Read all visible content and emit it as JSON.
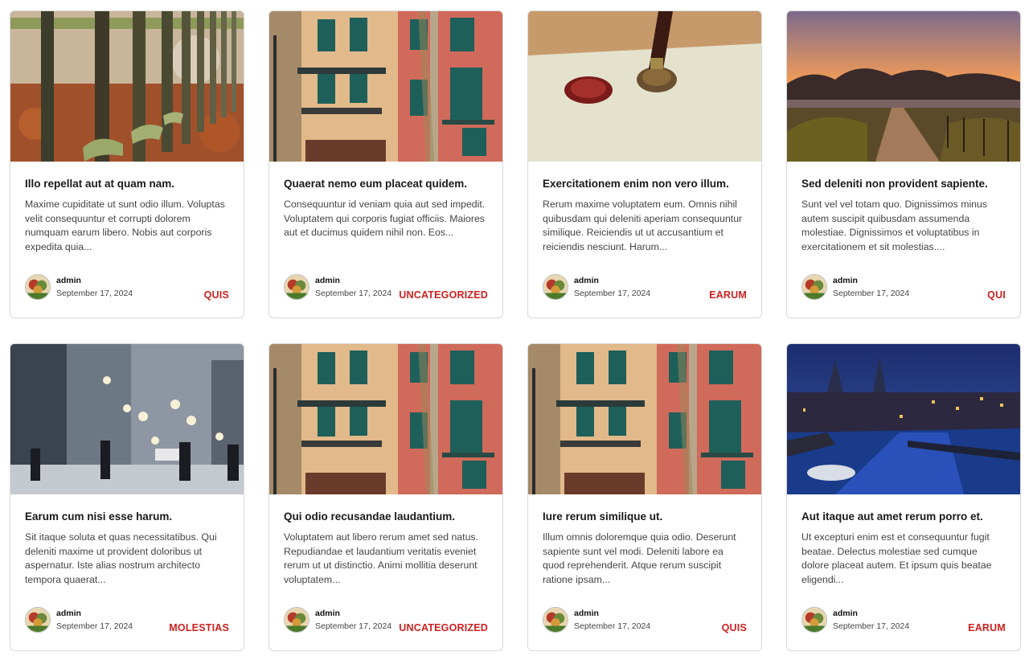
{
  "colors": {
    "accent": "#d0201f",
    "card_border": "#d9d9d9"
  },
  "posts": [
    {
      "image": "wooden-fence-photo",
      "title": "Illo repellat aut at quam nam.",
      "excerpt": "Maxime cupiditate ut sunt odio illum. Voluptas velit consequuntur et corrupti dolorem numquam earum libero. Nobis aut corporis expedita quia...",
      "author": "admin",
      "date": "September 17, 2024",
      "category": "QUIS"
    },
    {
      "image": "colorful-building-photo",
      "title": "Quaerat nemo eum placeat quidem.",
      "excerpt": "Consequuntur id veniam quia aut sed impedit. Voluptatem qui corporis fugiat officiis. Maiores aut et ducimus quidem nihil non. Eos...",
      "author": "admin",
      "date": "September 17, 2024",
      "category": "UNCATEGORIZED"
    },
    {
      "image": "wax-seal-photo",
      "title": "Exercitationem enim non vero illum.",
      "excerpt": "Rerum maxime voluptatem eum. Omnis nihil quibusdam qui deleniti aperiam consequuntur similique. Reiciendis ut ut accusantium et reiciendis nesciunt. Harum...",
      "author": "admin",
      "date": "September 17, 2024",
      "category": "EARUM"
    },
    {
      "image": "sunrise-path-photo",
      "title": "Sed deleniti non provident sapiente.",
      "excerpt": "Sunt vel vel totam quo. Dignissimos minus autem suscipit quibusdam assumenda molestiae. Dignissimos et voluptatibus in exercitationem et sit molestias....",
      "author": "admin",
      "date": "September 17, 2024",
      "category": "QUI"
    },
    {
      "image": "snowy-street-photo",
      "title": "Earum cum nisi esse harum.",
      "excerpt": "Sit itaque soluta et quas necessitatibus. Qui deleniti maxime ut provident doloribus ut aspernatur. Iste alias nostrum architecto tempora quaerat...",
      "author": "admin",
      "date": "September 17, 2024",
      "category": "MOLESTIAS"
    },
    {
      "image": "colorful-building-photo",
      "title": "Qui odio recusandae laudantium.",
      "excerpt": "Voluptatem aut libero rerum amet sed natus. Repudiandae et laudantium veritatis eveniet rerum ut ut distinctio. Animi mollitia deserunt voluptatem...",
      "author": "admin",
      "date": "September 17, 2024",
      "category": "UNCATEGORIZED"
    },
    {
      "image": "colorful-building-photo",
      "title": "Iure rerum similique ut.",
      "excerpt": "Illum omnis doloremque quia odio. Deserunt sapiente sunt vel modi. Deleniti labore ea quod reprehenderit. Atque rerum suscipit ratione ipsam...",
      "author": "admin",
      "date": "September 17, 2024",
      "category": "QUIS"
    },
    {
      "image": "night-canal-photo",
      "title": "Aut itaque aut amet rerum porro et.",
      "excerpt": "Ut excepturi enim est et consequuntur fugit beatae. Delectus molestiae sed cumque dolore placeat autem. Et ipsum quis beatae eligendi...",
      "author": "admin",
      "date": "September 17, 2024",
      "category": "EARUM"
    }
  ]
}
